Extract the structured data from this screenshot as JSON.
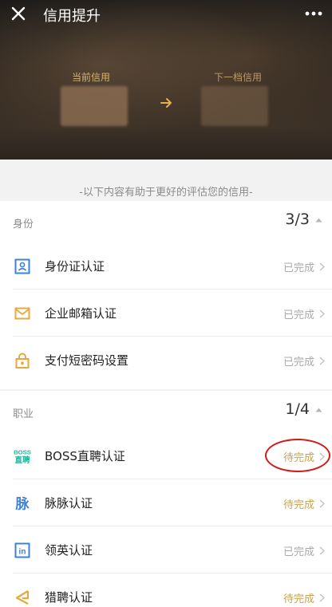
{
  "topbar": {
    "title": "信用提升",
    "close_icon": "close-icon",
    "more_icon": "more-icon"
  },
  "hero": {
    "current_label": "当前信用",
    "next_label": "下一档信用",
    "arrow_icon": "arrow-right-icon",
    "accent_color": "#d8b46f"
  },
  "hint": "-以下内容有助于更好的评估您的信用-",
  "identity": {
    "title": "身份",
    "count": "3/3",
    "items": [
      {
        "label": "身份证认证",
        "status": "已完成",
        "icon": "id-card-icon",
        "done": true
      },
      {
        "label": "企业邮箱认证",
        "status": "已完成",
        "icon": "mail-icon",
        "done": true
      },
      {
        "label": "支付短密码设置",
        "status": "已完成",
        "icon": "lock-icon",
        "done": true
      }
    ]
  },
  "career": {
    "title": "职业",
    "count": "1/4",
    "items": [
      {
        "label": "BOSS直聘认证",
        "status": "待完成",
        "icon": "boss-zhipin-icon",
        "done": false,
        "logo_text_top": "BOSS",
        "logo_text_bottom": "直聘"
      },
      {
        "label": "脉脉认证",
        "status": "待完成",
        "icon": "maimai-icon",
        "done": false,
        "logo_text": "脉"
      },
      {
        "label": "领英认证",
        "status": "已完成",
        "icon": "linkedin-icon",
        "done": true,
        "logo_text": "in"
      },
      {
        "label": "猎聘认证",
        "status": "待完成",
        "icon": "liepin-icon",
        "done": false
      }
    ]
  },
  "colors": {
    "done": "#aaaaaa",
    "todo": "#c9a24f",
    "highlight": "#d11a1a"
  }
}
